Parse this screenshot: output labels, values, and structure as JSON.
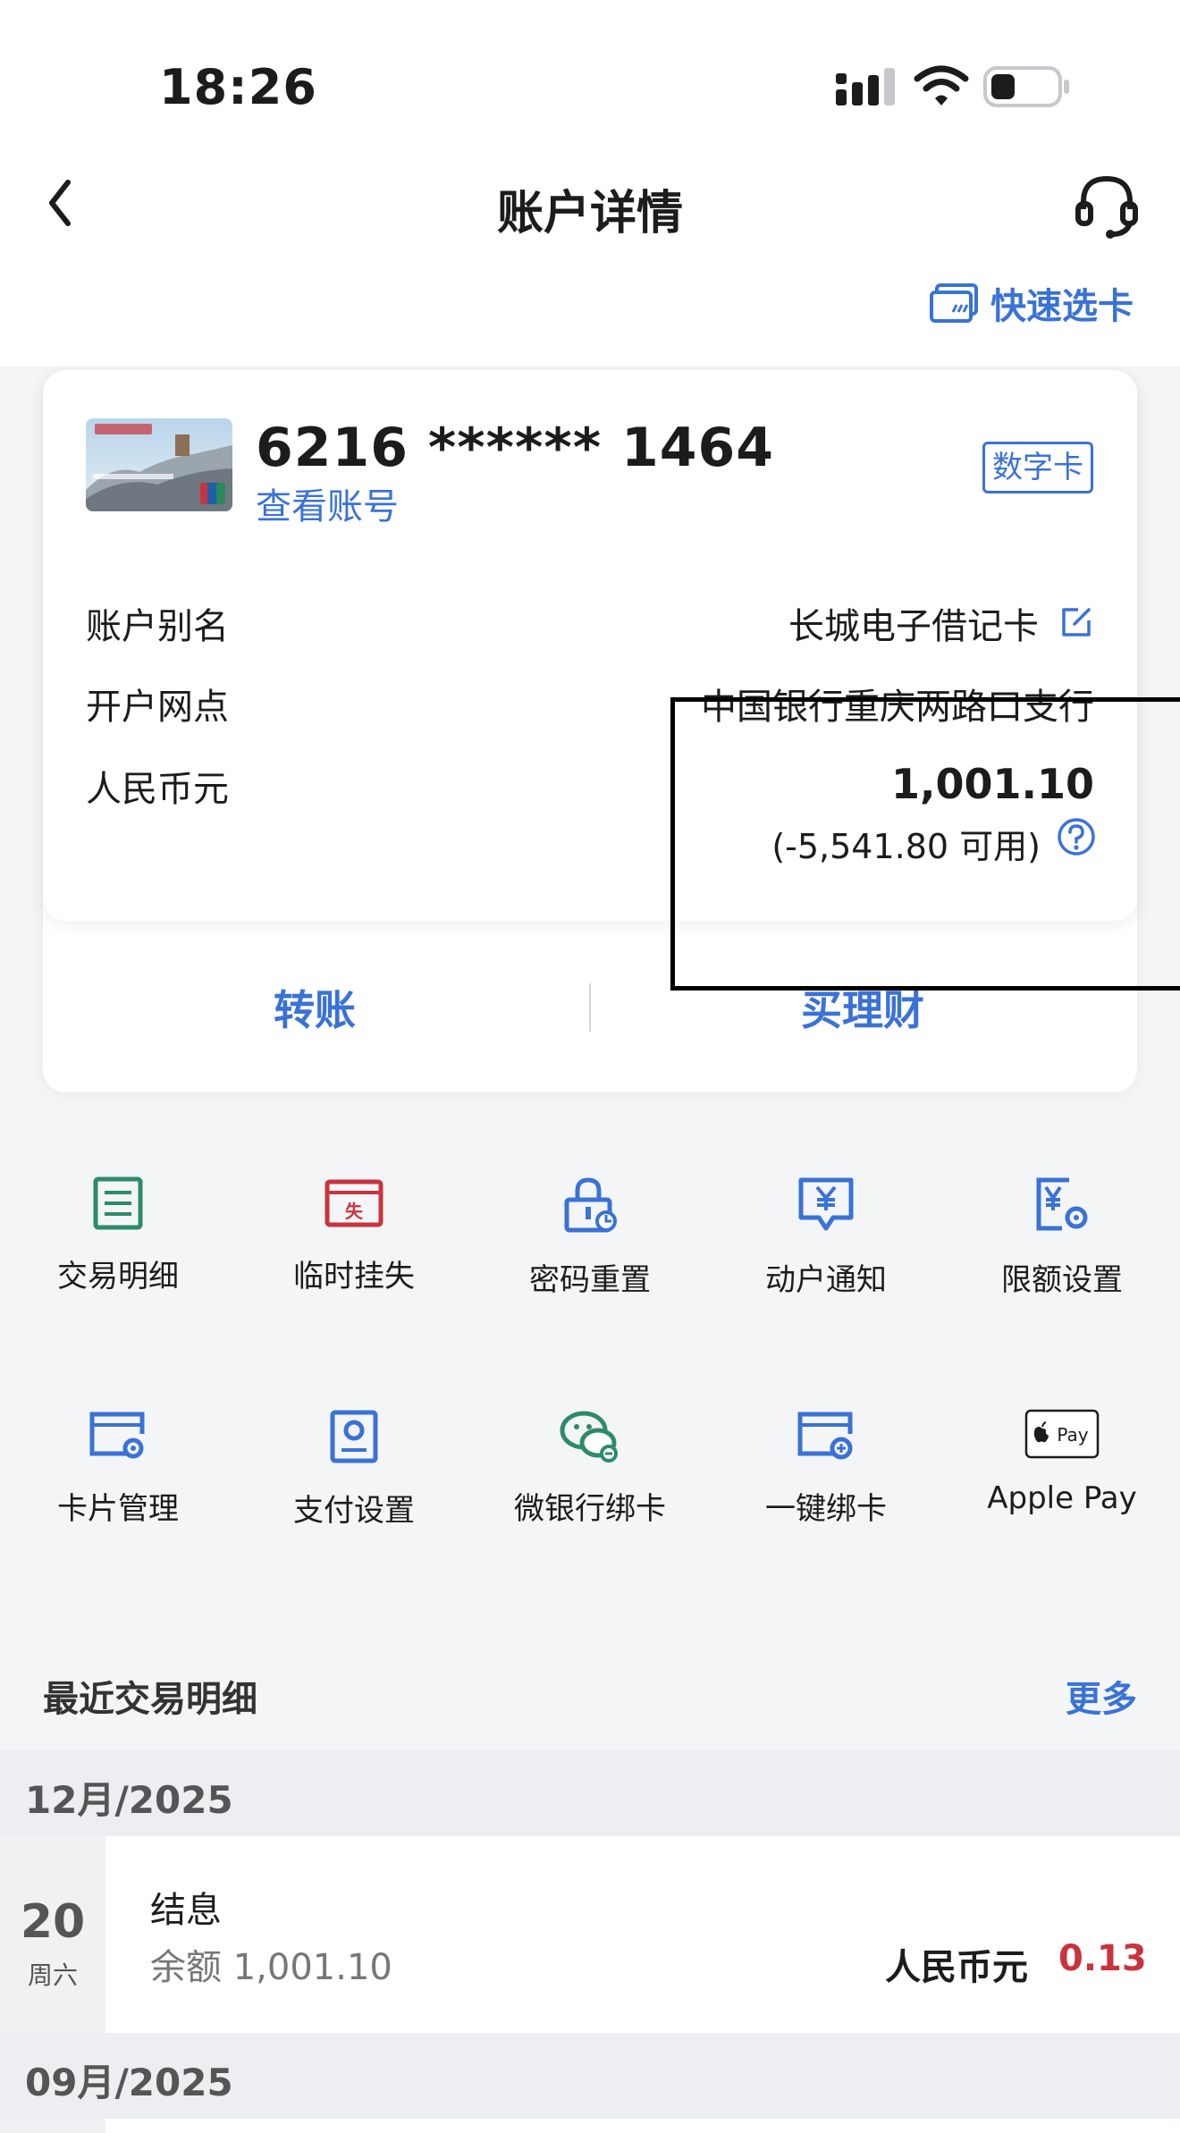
{
  "status_bar": {
    "time": "18:26"
  },
  "nav": {
    "title": "账户详情"
  },
  "quick_select": {
    "label": "快速选卡"
  },
  "card": {
    "number": "6216 ****** 1464",
    "view_account": "查看账号",
    "badge": "数字卡",
    "rows": {
      "alias_label": "账户别名",
      "alias_value": "长城电子借记卡",
      "branch_label": "开户网点",
      "branch_value": "中国银行重庆两路口支行",
      "currency_label": "人民币元",
      "balance": "1,001.10",
      "available": "(-5,541.80 可用)"
    },
    "actions": {
      "transfer": "转账",
      "wealth": "买理财"
    }
  },
  "grid": {
    "items": [
      {
        "label": "交易明细",
        "icon": "list-doc-icon",
        "color": "#2e8b6a"
      },
      {
        "label": "临时挂失",
        "icon": "loss-report-icon",
        "color": "#c8343e"
      },
      {
        "label": "密码重置",
        "icon": "lock-reset-icon",
        "color": "#3a72d6"
      },
      {
        "label": "动户通知",
        "icon": "yuan-notify-icon",
        "color": "#3a72d6"
      },
      {
        "label": "限额设置",
        "icon": "yuan-settings-icon",
        "color": "#3a72d6"
      },
      {
        "label": "卡片管理",
        "icon": "card-gear-icon",
        "color": "#3a72d6"
      },
      {
        "label": "支付设置",
        "icon": "payment-settings-icon",
        "color": "#3a72d6"
      },
      {
        "label": "微银行绑卡",
        "icon": "wechat-bind-icon",
        "color": "#2e8b6a"
      },
      {
        "label": "一键绑卡",
        "icon": "card-link-icon",
        "color": "#3a72d6"
      },
      {
        "label": "Apple Pay",
        "icon": "apple-pay-icon",
        "color": "#1c1c1e"
      }
    ]
  },
  "recent": {
    "title": "最近交易明细",
    "more": "更多",
    "months": [
      "12月/2025",
      "09月/2025"
    ],
    "transactions": [
      {
        "day": "20",
        "weekday": "周六",
        "title": "结息",
        "balance": "余额 1,001.10",
        "currency": "人民币元",
        "amount": "0.13"
      }
    ]
  },
  "colors": {
    "accent": "#3a72d6",
    "negative": "#c8343e",
    "green": "#2e8b6a"
  }
}
